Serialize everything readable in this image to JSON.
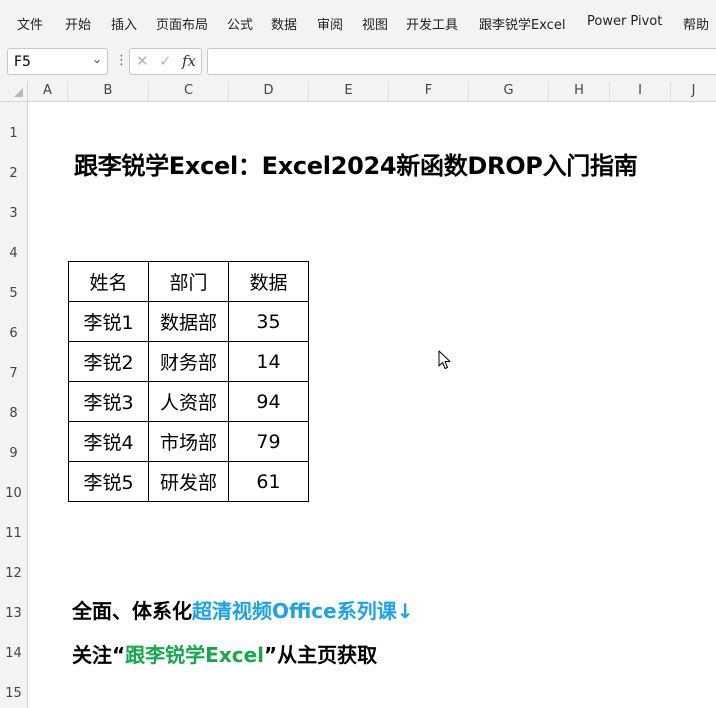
{
  "ribbon": {
    "tabs": [
      "文件",
      "开始",
      "插入",
      "页面布局",
      "公式",
      "数据",
      "审阅",
      "视图",
      "开发工具",
      "跟李锐学Excel",
      "Power Pivot",
      "帮助"
    ]
  },
  "formula_bar": {
    "name_box": "F5",
    "cancel_icon": "✕",
    "enter_icon": "✓",
    "fx_label": "fx",
    "formula": ""
  },
  "columns": [
    "A",
    "B",
    "C",
    "D",
    "E",
    "F",
    "G",
    "H",
    "I",
    "J"
  ],
  "rows": [
    "1",
    "2",
    "3",
    "4",
    "5",
    "6",
    "7",
    "8",
    "9",
    "10",
    "11",
    "12",
    "13",
    "14",
    "15"
  ],
  "sheet": {
    "title": "跟李锐学Excel：Excel2024新函数DROP入门指南",
    "table": {
      "headers": [
        "姓名",
        "部门",
        "数据"
      ],
      "rows": [
        [
          "李锐1",
          "数据部",
          "35"
        ],
        [
          "李锐2",
          "财务部",
          "14"
        ],
        [
          "李锐3",
          "人资部",
          "94"
        ],
        [
          "李锐4",
          "市场部",
          "79"
        ],
        [
          "李锐5",
          "研发部",
          "61"
        ]
      ]
    },
    "promo1": {
      "black": "全面、体系化",
      "blue": "超清视频Office系列课↓"
    },
    "promo2": {
      "black_start": "关注“",
      "green": "跟李锐学Excel",
      "black_end": "”从主页获取"
    }
  },
  "colors": {
    "promo_blue": "#1ea2e6",
    "promo_green": "#16a84a",
    "chrome_bg": "#f3f3f3"
  }
}
